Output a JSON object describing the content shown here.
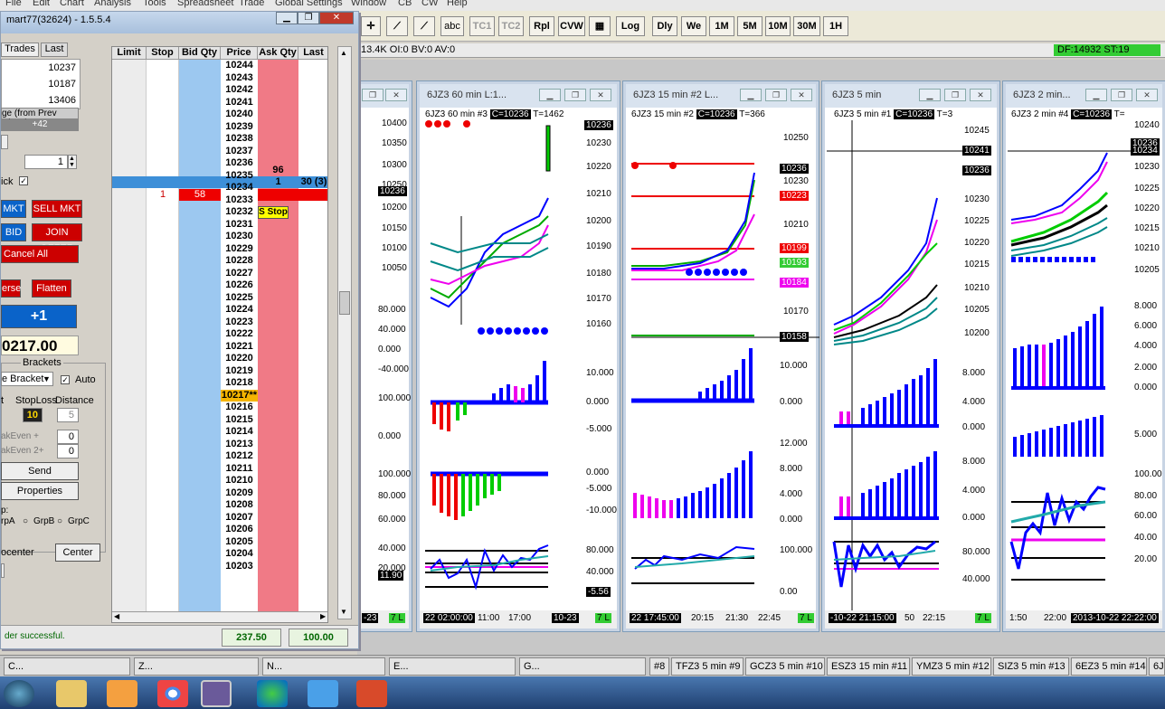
{
  "menu": [
    "File",
    "Edit",
    "Chart",
    "Analysis",
    "Tools",
    "Spreadsheet",
    "Trade",
    "Global Settings",
    "Window",
    "CB",
    "CW",
    "Help"
  ],
  "toolbar": {
    "labels": [
      "abc",
      "TC1",
      "TC2",
      "Rpl",
      "CVW",
      "Log",
      "Dly",
      "We",
      "1M",
      "5M",
      "10M",
      "30M",
      "1H"
    ]
  },
  "status": {
    "left": "13.4K  OI:0  BV:0  AV:0",
    "right": "DF:14932  ST:19"
  },
  "dom": {
    "title": "mart77(32624) - 1.5.5.4",
    "tabs": [
      "Trades",
      "Last"
    ],
    "values": [
      "10237",
      "10187",
      "13406"
    ],
    "change_label": "ge (from Prev Close)",
    "change_value": "+42",
    "qty": "1",
    "click_label": "ick",
    "buttons": {
      "buy_mkt": "MKT",
      "sell_mkt": "SELL MKT",
      "buy_bid": "BID",
      "join_offer": "JOIN OFFER",
      "cancel_all": "Cancel All",
      "reverse": "erse",
      "flatten": "Flatten",
      "plus_one": "+1",
      "send_bracket": "Send BracketOrd",
      "properties": "Properties",
      "recenter": "ocenter",
      "center": "Center"
    },
    "price_big": "0217.00",
    "brackets_label": "Brackets",
    "bracket_select": "e Bracket",
    "auto_label": "Auto",
    "stoploss_label": "StopLoss",
    "distance_label": "Distance",
    "t_label": "t",
    "stoploss_val": "10",
    "distance_val": "5",
    "breakeven1": "akEven +",
    "breakeven2": "akEven 2+",
    "be1_val": "0",
    "be2_val": "0",
    "group_label": "p:",
    "groups": [
      "rpA",
      "GrpB",
      "GrpC"
    ],
    "status_msg": "der successful.",
    "footer_vals": [
      "237.50",
      "100.00"
    ],
    "headers": [
      "Limit",
      "Stop",
      "Bid Qty",
      "Price",
      "Ask Qty",
      "Last"
    ],
    "prices": [
      "10244",
      "10243",
      "10242",
      "10241",
      "10240",
      "10239",
      "10238",
      "10237",
      "10236",
      "10235",
      "10234",
      "10233",
      "10232",
      "10231",
      "10230",
      "10229",
      "10228",
      "10227",
      "10226",
      "10225",
      "10224",
      "10223",
      "10222",
      "10221",
      "10220",
      "10219",
      "10218",
      "10217**",
      "10216",
      "10215",
      "10214",
      "10213",
      "10212",
      "10211",
      "10210",
      "10209",
      "10208",
      "10207",
      "10206",
      "10205",
      "10204",
      "10203"
    ],
    "ask_qty_10237": "96",
    "ask_qty_10236": "1",
    "last_10236": "30 (3)",
    "stop_10235": "1",
    "bid_10235": "58",
    "stop_order": "S Stop"
  },
  "charts": [
    {
      "title": "6JZ3  60 min  L:1...",
      "info": "6JZ3  60 min  #3",
      "c": "C=10236",
      "t": "T=1462",
      "price": "10236",
      "axis": [
        "10400",
        "10350",
        "10300",
        "10250",
        "10200",
        "10150",
        "10100",
        "10050"
      ],
      "axis2": [
        "10230",
        "10220",
        "10210",
        "10200",
        "10190",
        "10180",
        "10170",
        "10160"
      ],
      "ind_axis": [
        "80.000",
        "40.000",
        "0.000",
        "-40.000",
        "100.000",
        "0.000",
        "100.000",
        "80.000",
        "60.000",
        "40.000",
        "20.000"
      ],
      "ind_axis2": [
        "10.000",
        "0.000",
        "-5.000",
        "0.000",
        "-5.000",
        "-10.000",
        "80.000",
        "40.000",
        "-5.56"
      ],
      "times": [
        "22  02:00:00",
        "11:00",
        "17:00",
        "10-23"
      ],
      "foot_tag": "7 L",
      "left_tag": "10236",
      "left_times": [
        "-23"
      ],
      "low_tag": "11.90"
    },
    {
      "title": "6JZ3  15 min  #2  L...",
      "info": "6JZ3  15 min  #2",
      "c": "C=10236",
      "t": "T=366",
      "axis": [
        "10250",
        "10236",
        "10230",
        "10223",
        "10210",
        "10199",
        "10193",
        "10184",
        "10170",
        "10158"
      ],
      "ind_axis": [
        "10.000",
        "0.000",
        "12.000",
        "8.000",
        "4.000",
        "0.000",
        "100.000",
        "0.00"
      ],
      "times": [
        "22  17:45:00",
        "20:15",
        "21:30",
        "22:45"
      ],
      "foot_tag": "7 L"
    },
    {
      "title": "6JZ3  5 min",
      "info": "6JZ3  5 min  #1",
      "c": "C=10236",
      "t": "T=3",
      "axis": [
        "10245",
        "10241",
        "10236",
        "10230",
        "10225",
        "10220",
        "10215",
        "10210",
        "10205",
        "10200"
      ],
      "ind_axis": [
        "8.000",
        "4.000",
        "0.000",
        "8.000",
        "4.000",
        "0.000",
        "80.000",
        "40.000"
      ],
      "times": [
        "-10-22  21:15:00",
        "50",
        "22:15"
      ],
      "foot_tag": "7 L"
    },
    {
      "title": "6JZ3  2 min...",
      "info": "6JZ3  2 min  #4",
      "c": "C=10236",
      "t": "T=",
      "axis": [
        "10240",
        "10236",
        "10234",
        "10230",
        "10225",
        "10220",
        "10215",
        "10210",
        "10205"
      ],
      "ind_axis": [
        "8.000",
        "6.000",
        "4.000",
        "2.000",
        "0.000",
        "5.000",
        "100.00",
        "80.00",
        "60.00",
        "40.00",
        "20.00"
      ],
      "times": [
        "1:50",
        "22:00",
        "2013-10-22  22:22:00"
      ]
    }
  ],
  "tabs": [
    "C...",
    "Z...",
    "N...",
    "E...",
    "G...",
    "#8",
    "TFZ3  5 min  #9",
    "GCZ3  5 min  #10",
    "ESZ3  15 min  #11",
    "YMZ3  5 min  #12",
    "SIZ3  5 min  #13",
    "6EZ3  5 min  #14",
    "6JZ"
  ]
}
